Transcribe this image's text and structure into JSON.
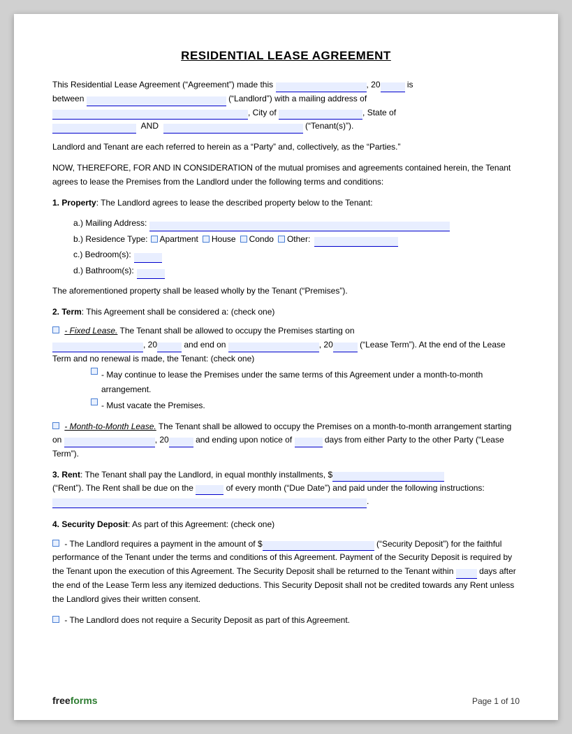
{
  "title": "RESIDENTIAL LEASE AGREEMENT",
  "intro": {
    "line1": "This Residential Lease Agreement (“Agreement”) made this",
    "year_prefix": ", 20",
    "year_suffix": "is",
    "line2_prefix": "between",
    "landlord_suffix": "(“Landlord”) with a mailing address of",
    "city_prefix": ", City of",
    "state_suffix": ", State of",
    "and_label": "AND",
    "tenants_suffix": "(“Tenant(s)”)."
  },
  "parties_note": "Landlord and Tenant are each referred to herein as a “Party” and, collectively, as the “Parties.”",
  "consideration": "NOW, THEREFORE, FOR AND IN CONSIDERATION of the mutual promises and agreements contained herein, the Tenant agrees to lease the Premises from the Landlord under the following terms and conditions:",
  "section1": {
    "heading": "1. Property",
    "heading_rest": ": The Landlord agrees to lease the described property below to the Tenant:",
    "a_label": "a.)  Mailing Address:",
    "b_label": "b.)  Residence Type:",
    "b_options": [
      "Apartment",
      "House",
      "Condo",
      "Other:"
    ],
    "c_label": "c.)  Bedroom(s):",
    "d_label": "d.)  Bathroom(s):",
    "premises_note": "The aforementioned property shall be leased wholly by the Tenant (“Premises”)."
  },
  "section2": {
    "heading": "2. Term",
    "heading_rest": ": This Agreement shall be considered a: (check one)",
    "fixed_lease_label": "- Fixed Lease.",
    "fixed_lease_text": "The Tenant shall be allowed to occupy the Premises starting on",
    "fixed_lease_mid": ", 20",
    "fixed_lease_end_prefix": "and end on",
    "fixed_lease_end_mid": ", 20",
    "fixed_lease_end_suffix": "(“Lease Term”). At the end of the Lease Term and no renewal is made, the Tenant: (check one)",
    "option1": "- May continue to lease the Premises under the same terms of this Agreement under a month-to-month arrangement.",
    "option2": "- Must vacate the Premises.",
    "month_label": "- Month-to-Month Lease.",
    "month_text": "The Tenant shall be allowed to occupy the Premises on a month-to-month arrangement starting on",
    "month_mid": ", 20",
    "month_end": "and ending upon notice of",
    "month_days": "days from either Party to the other Party (“Lease Term”)."
  },
  "section3": {
    "heading": "3. Rent",
    "heading_rest": ": The Tenant shall pay the Landlord, in equal monthly installments, $",
    "rent_suffix": "(“Rent”). The Rent shall be due on the",
    "due_mid": "of every month (“Due Date”) and paid under the following instructions:",
    "instructions_end": "."
  },
  "section4": {
    "heading": "4. Security Deposit",
    "heading_rest": ": As part of this Agreement: (check one)",
    "option1_prefix": "- The Landlord requires a payment in the amount of $",
    "option1_mid": "(“Security Deposit”) for the faithful performance of the Tenant under the terms and conditions of this Agreement. Payment of the Security Deposit is required by the Tenant upon the execution of this Agreement. The Security Deposit shall be returned to the Tenant within",
    "option1_days_after": "days after the end of the Lease Term less any itemized deductions. This Security Deposit shall not be credited towards any Rent unless the Landlord gives their written consent.",
    "option2": "- The Landlord does not require a Security Deposit as part of this Agreement."
  },
  "footer": {
    "logo_free": "free",
    "logo_forms": "forms",
    "page_label": "Page 1 of 10"
  }
}
